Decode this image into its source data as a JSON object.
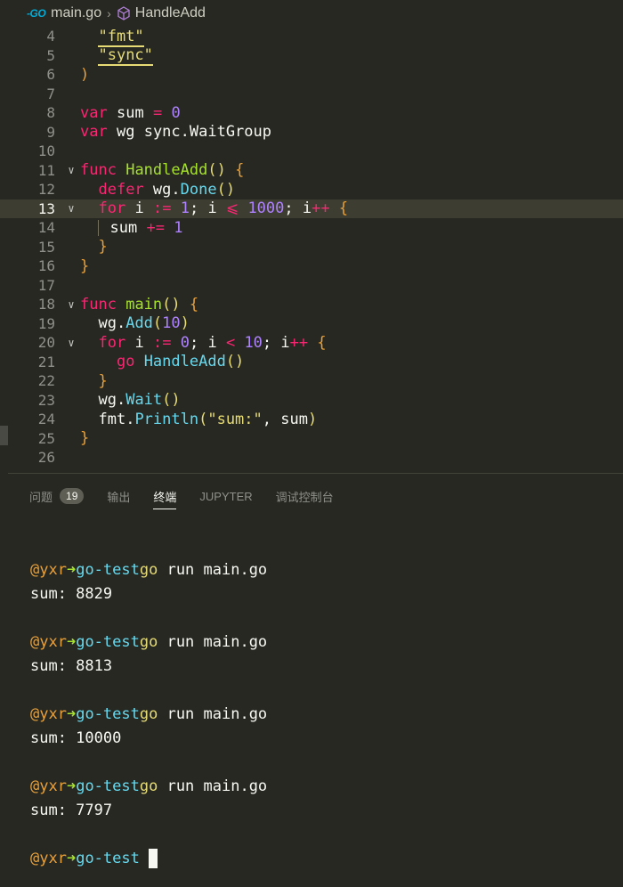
{
  "breadcrumb": {
    "file_icon": "go-file-icon",
    "file_icon_text": "-GO",
    "file": "main.go",
    "symbol": "HandleAdd"
  },
  "editor": {
    "lines": [
      {
        "no": "4"
      },
      {
        "no": "5"
      },
      {
        "no": "6"
      },
      {
        "no": "7"
      },
      {
        "no": "8"
      },
      {
        "no": "9"
      },
      {
        "no": "10"
      },
      {
        "no": "11"
      },
      {
        "no": "12"
      },
      {
        "no": "13"
      },
      {
        "no": "14"
      },
      {
        "no": "15"
      },
      {
        "no": "16"
      },
      {
        "no": "17"
      },
      {
        "no": "18"
      },
      {
        "no": "19"
      },
      {
        "no": "20"
      },
      {
        "no": "21"
      },
      {
        "no": "22"
      },
      {
        "no": "23"
      },
      {
        "no": "24"
      },
      {
        "no": "25"
      },
      {
        "no": "26"
      }
    ],
    "tokens": {
      "fmt": "\"fmt\"",
      "sync": "\"sync\"",
      "close_paren": ")",
      "var": "var",
      "sum": "sum",
      "eq": "=",
      "zero": "0",
      "wg": "wg",
      "sync_waitgroup": "sync.WaitGroup",
      "func": "func",
      "handleadd": "HandleAdd",
      "parens": "()",
      "lbrace": "{",
      "rbrace": "}",
      "defer": "defer",
      "wg_dot": "wg.",
      "done": "Done",
      "for": "for",
      "i": "i",
      "decl": ":=",
      "one": "1",
      "semi": ";",
      "le": "⩽",
      "thousand": "1000",
      "inc": "++",
      "plus_eq": "+=",
      "main": "main",
      "add": "Add",
      "ten": "10",
      "lparen": "(",
      "rparen": ")",
      "lt": "<",
      "go": "go",
      "wait": "Wait",
      "fmt_dot": "fmt.",
      "println": "Println",
      "sum_str": "\"sum:\"",
      "comma_sum": ", sum"
    }
  },
  "panel": {
    "tabs": [
      {
        "label": "问题",
        "badge": "19"
      },
      {
        "label": "输出"
      },
      {
        "label": "终端",
        "active": true
      },
      {
        "label": "JUPYTER"
      },
      {
        "label": "调试控制台"
      }
    ]
  },
  "terminal": {
    "user": "@yxr",
    "arrow": "➜",
    "dir": "go-test",
    "runs": [
      {
        "cmd": "go",
        "args": " run main.go",
        "output": "sum: 8829"
      },
      {
        "cmd": "go",
        "args": " run main.go",
        "output": "sum: 8813"
      },
      {
        "cmd": "go",
        "args": " run main.go",
        "output": "sum: 10000"
      },
      {
        "cmd": "go",
        "args": " run main.go",
        "output": "sum: 7797"
      }
    ]
  },
  "colors": {
    "background": "#272822",
    "keyword": "#f92672",
    "function": "#a6e22e",
    "method": "#66d9ef",
    "number": "#ae81ff",
    "string": "#e6db74"
  }
}
